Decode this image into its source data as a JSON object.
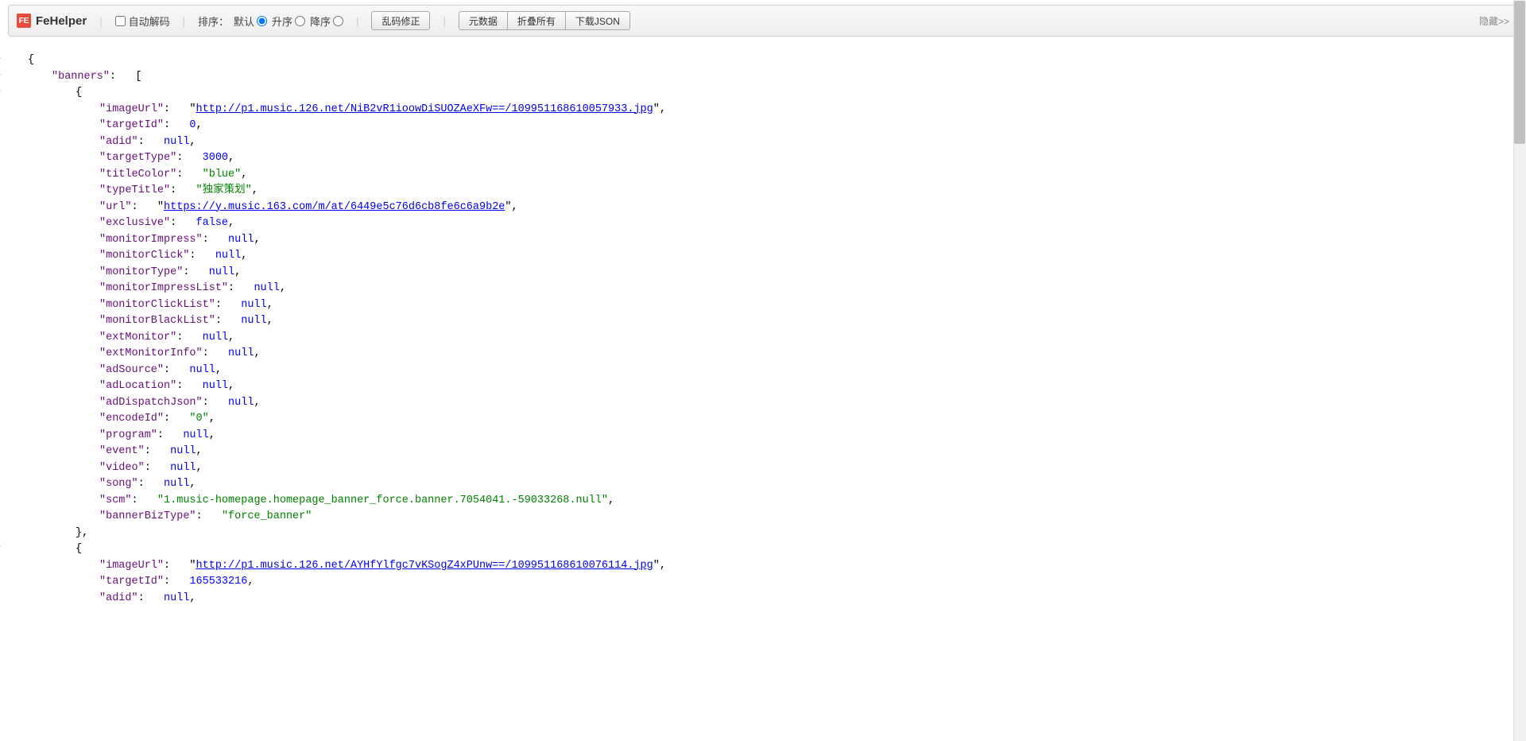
{
  "toolbar": {
    "appName": "FeHelper",
    "logoLetter": "FE",
    "autoDecode": "自动解码",
    "sortLabel": "排序：",
    "sortDefault": "默认",
    "sortAsc": "升序",
    "sortDesc": "降序",
    "fixEncoding": "乱码修正",
    "metadata": "元数据",
    "collapseAll": "折叠所有",
    "downloadJson": "下载JSON",
    "hide": "隐藏>>"
  },
  "json": {
    "rootKey": "banners",
    "banners": [
      {
        "imageUrl": "http://p1.music.126.net/NiB2vR1ioowDiSUOZAeXFw==/109951168610057933.jpg",
        "targetId": 0,
        "adid": null,
        "targetType": 3000,
        "titleColor": "blue",
        "typeTitle": "独家策划",
        "url": "https://y.music.163.com/m/at/6449e5c76d6cb8fe6c6a9b2e",
        "exclusive": false,
        "monitorImpress": null,
        "monitorClick": null,
        "monitorType": null,
        "monitorImpressList": null,
        "monitorClickList": null,
        "monitorBlackList": null,
        "extMonitor": null,
        "extMonitorInfo": null,
        "adSource": null,
        "adLocation": null,
        "adDispatchJson": null,
        "encodeId": "0",
        "program": null,
        "event": null,
        "video": null,
        "song": null,
        "scm": "1.music-homepage.homepage_banner_force.banner.7054041.-59033268.null",
        "bannerBizType": "force_banner"
      },
      {
        "imageUrl": "http://p1.music.126.net/AYHfYlfgc7vKSogZ4xPUnw==/109951168610076114.jpg",
        "targetId": 165533216,
        "adid": null
      }
    ]
  }
}
